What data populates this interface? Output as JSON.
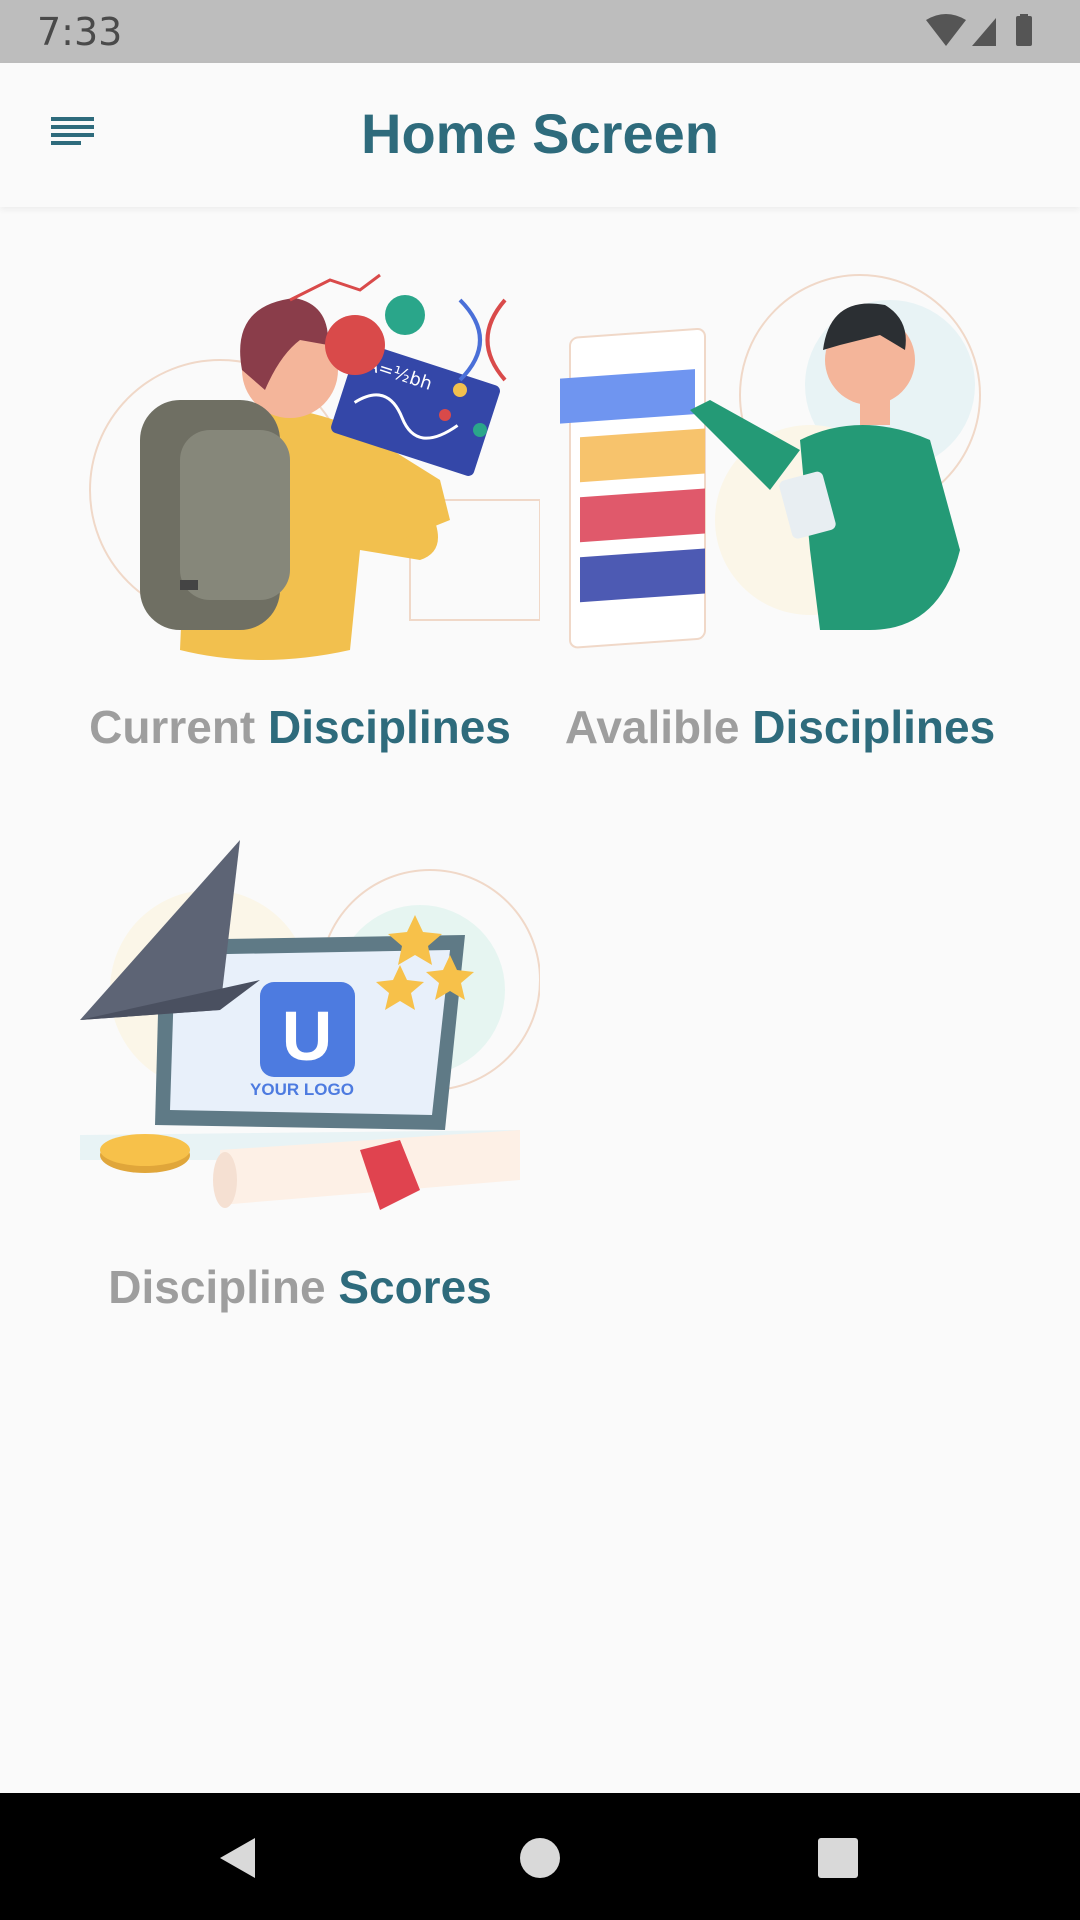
{
  "status_bar": {
    "time": "7:33",
    "icons": [
      "wifi-icon",
      "cell-signal-icon",
      "battery-icon"
    ]
  },
  "app_bar": {
    "title": "Home Screen",
    "menu_icon": "menu-icon"
  },
  "cards": [
    {
      "label_prefix": "Current",
      "label_suffix": "Disciplines",
      "illustration": "student-with-backpack"
    },
    {
      "label_prefix": "Avalible",
      "label_suffix": "Disciplines",
      "illustration": "man-with-list-board"
    },
    {
      "label_prefix": "Discipline",
      "label_suffix": "Scores",
      "illustration": "graduation-laptop",
      "logo_text": "YOUR LOGO",
      "logo_letter": "U"
    }
  ],
  "nav_bar": {
    "buttons": [
      "back-icon",
      "home-icon",
      "recents-icon"
    ]
  },
  "colors": {
    "primary": "#2e6b7c",
    "secondary_text": "#9e9e9e",
    "background": "#fafafa"
  }
}
